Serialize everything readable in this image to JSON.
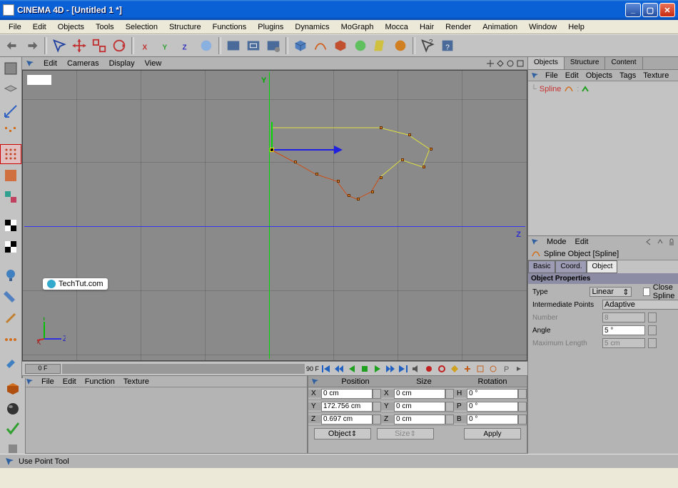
{
  "titlebar": {
    "title": "CINEMA 4D - [Untitled 1 *]"
  },
  "menubar": [
    "File",
    "Edit",
    "Objects",
    "Tools",
    "Selection",
    "Structure",
    "Functions",
    "Plugins",
    "Dynamics",
    "MoGraph",
    "Mocca",
    "Hair",
    "Render",
    "Animation",
    "Window",
    "Help"
  ],
  "viewport_menu": {
    "items": [
      "Edit",
      "Cameras",
      "Display",
      "View"
    ],
    "axis_y": "Y",
    "axis_z": "Z"
  },
  "mini_axis": {
    "y": "Y",
    "x": "X",
    "z": "Z"
  },
  "timeline": {
    "current": "0 F",
    "end": "90 F"
  },
  "material_menu": [
    "File",
    "Edit",
    "Function",
    "Texture"
  ],
  "coord": {
    "header": [
      "Position",
      "Size",
      "Rotation"
    ],
    "rows": [
      {
        "a": "X",
        "av": "0 cm",
        "b": "X",
        "bv": "0 cm",
        "c": "H",
        "cv": "0 °"
      },
      {
        "a": "Y",
        "av": "172.756 cm",
        "b": "Y",
        "bv": "0 cm",
        "c": "P",
        "cv": "0 °"
      },
      {
        "a": "Z",
        "av": "0.697 cm",
        "b": "Z",
        "bv": "0 cm",
        "c": "B",
        "cv": "0 °"
      }
    ],
    "dd1": "Object",
    "dd2": "Size",
    "apply": "Apply"
  },
  "objects_panel": {
    "tabs": [
      "Objects",
      "Structure",
      "Content"
    ],
    "menu": [
      "File",
      "Edit",
      "Objects",
      "Tags",
      "Texture"
    ],
    "item": "Spline"
  },
  "attr": {
    "menu": [
      "Mode",
      "Edit"
    ],
    "title": "Spline Object [Spline]",
    "tabs": [
      "Basic",
      "Coord.",
      "Object"
    ],
    "section": "Object Properties",
    "type_label": "Type",
    "type_value": "Linear",
    "close_label": "Close Spline",
    "interp_label": "Intermediate Points",
    "interp_value": "Adaptive",
    "number_label": "Number",
    "number_value": "8",
    "angle_label": "Angle",
    "angle_value": "5 °",
    "maxlen_label": "Maximum Length",
    "maxlen_value": "5 cm"
  },
  "statusbar": {
    "text": "Use Point Tool"
  },
  "watermark": "TechTut.com"
}
